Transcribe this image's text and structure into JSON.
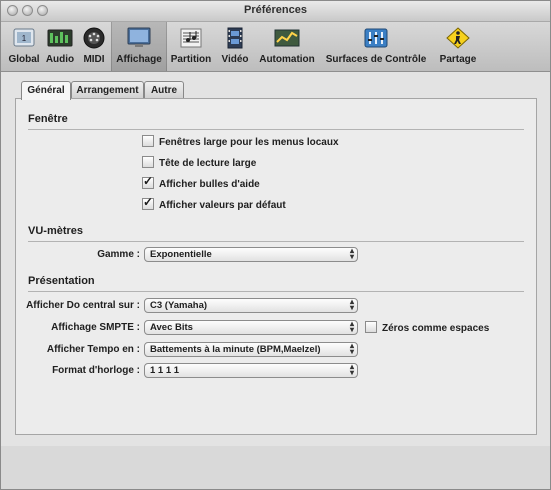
{
  "window": {
    "title": "Préférences"
  },
  "toolbar": {
    "items": [
      {
        "label": "Global"
      },
      {
        "label": "Audio"
      },
      {
        "label": "MIDI"
      },
      {
        "label": "Affichage"
      },
      {
        "label": "Partition"
      },
      {
        "label": "Vidéo"
      },
      {
        "label": "Automation"
      },
      {
        "label": "Surfaces de Contrôle"
      },
      {
        "label": "Partage"
      }
    ],
    "active": "Affichage"
  },
  "tabs": [
    {
      "label": "Général"
    },
    {
      "label": "Arrangement"
    },
    {
      "label": "Autre"
    }
  ],
  "fenetre": {
    "heading": "Fenêtre",
    "options": [
      {
        "label": "Fenêtres large pour les menus locaux",
        "checked": false
      },
      {
        "label": "Tête de lecture large",
        "checked": false
      },
      {
        "label": "Afficher bulles d'aide",
        "checked": true
      },
      {
        "label": "Afficher valeurs par défaut",
        "checked": true
      }
    ]
  },
  "vumetres": {
    "heading": "VU-mètres",
    "gamme_label": "Gamme :",
    "gamme_value": "Exponentielle"
  },
  "presentation": {
    "heading": "Présentation",
    "rows": [
      {
        "label": "Afficher Do central sur :",
        "value": "C3 (Yamaha)"
      },
      {
        "label": "Affichage SMPTE :",
        "value": "Avec Bits"
      },
      {
        "label": "Afficher Tempo en :",
        "value": "Battements à la minute (BPM,Maelzel)"
      },
      {
        "label": "Format d'horloge :",
        "value": "1 1 1 1"
      }
    ],
    "zeros_label": "Zéros comme espaces",
    "zeros_checked": false
  },
  "glyphs": {
    "check": "✓",
    "popup_up": "▴",
    "popup_down": "▾"
  }
}
